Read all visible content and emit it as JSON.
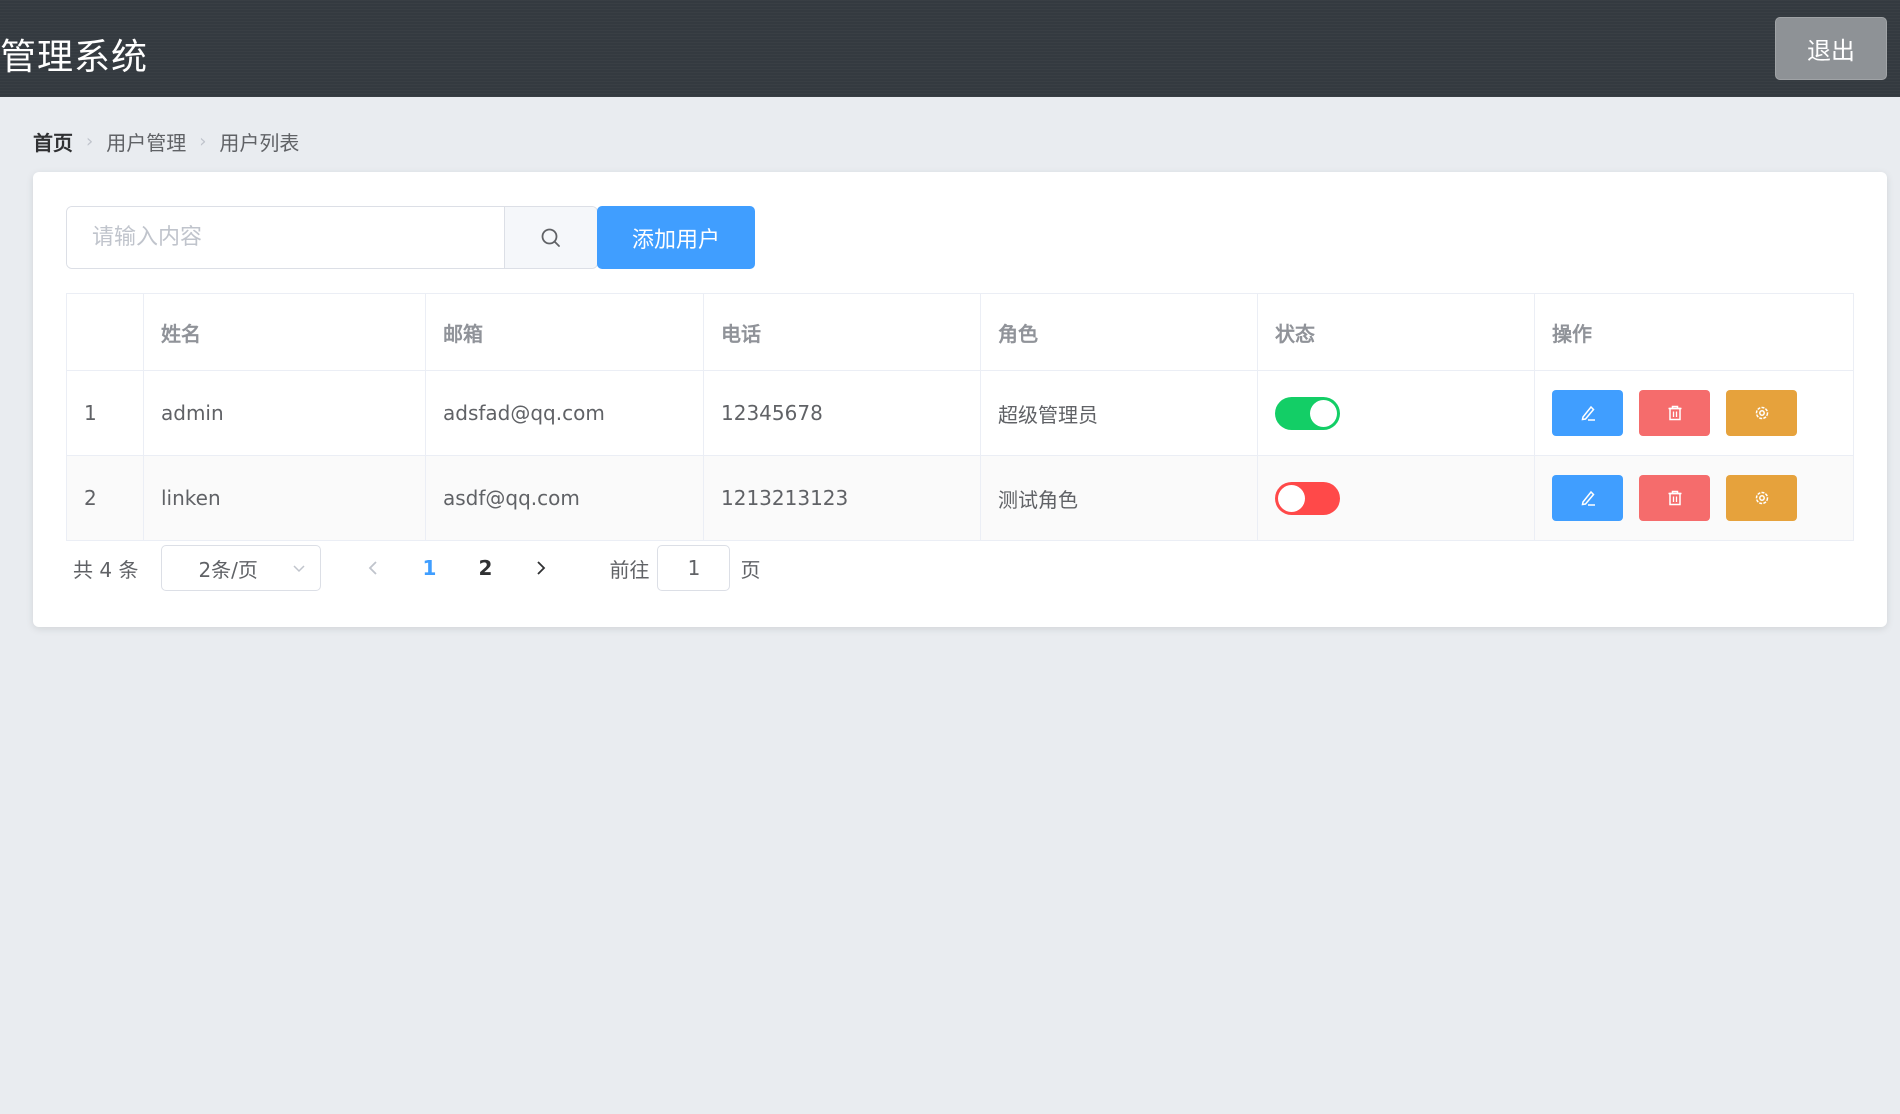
{
  "header": {
    "title": "管理系统",
    "logout_label": "退出"
  },
  "breadcrumb": [
    "首页",
    "用户管理",
    "用户列表"
  ],
  "toolbar": {
    "search_placeholder": "请输入内容",
    "search_value": "",
    "add_label": "添加用户"
  },
  "table": {
    "columns": [
      "",
      "姓名",
      "邮箱",
      "电话",
      "角色",
      "状态",
      "操作"
    ],
    "rows": [
      {
        "index": "1",
        "name": "admin",
        "email": "adsfad@qq.com",
        "phone": "12345678",
        "role": "超级管理员",
        "status": true
      },
      {
        "index": "2",
        "name": "linken",
        "email": "asdf@qq.com",
        "phone": "1213213123",
        "role": "测试角色",
        "status": false
      }
    ]
  },
  "pagination": {
    "total_label": "共 4 条",
    "page_size_label": "2条/页",
    "pages": [
      "1",
      "2"
    ],
    "current_page": "1",
    "goto_label": "前往",
    "goto_value": "1",
    "goto_suffix": "页"
  },
  "colors": {
    "primary": "#409eff",
    "danger": "#f56c6c",
    "warning": "#e6a23c",
    "switch_on": "#13ce66",
    "switch_off": "#ff4949"
  },
  "icons": {
    "edit": "edit-icon",
    "delete": "delete-icon",
    "settings": "settings-icon"
  }
}
